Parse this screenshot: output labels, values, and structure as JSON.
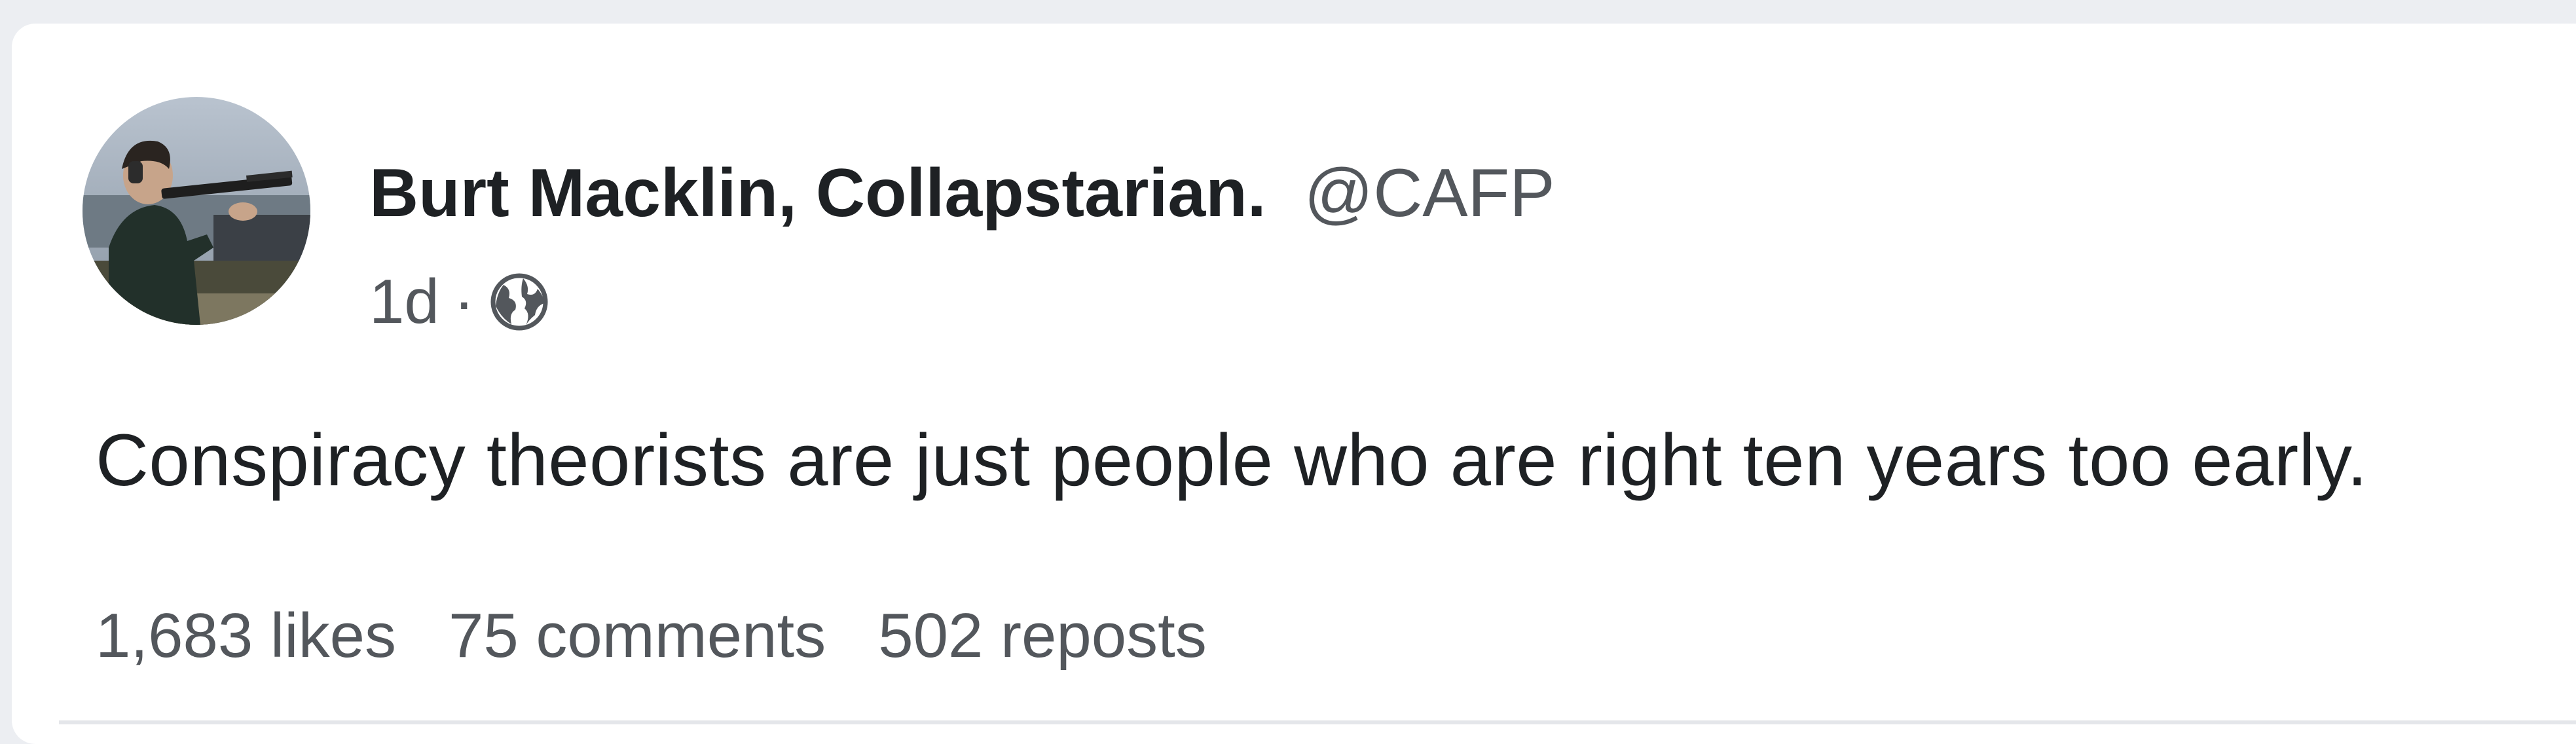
{
  "post": {
    "author_name": "Burt Macklin, Collapstarian.",
    "author_handle": "@CAFP",
    "age": "1d",
    "separator": "·",
    "visibility_icon": "globe-icon",
    "body": "Conspiracy theorists are just people who are right ten years too early.",
    "stats": {
      "likes": "1,683 likes",
      "comments": "75 comments",
      "reposts": "502 reposts"
    }
  },
  "colors": {
    "page_background": "#eceef2",
    "card_background": "#ffffff",
    "primary_text": "#1e2124",
    "secondary_text": "#53575c"
  }
}
